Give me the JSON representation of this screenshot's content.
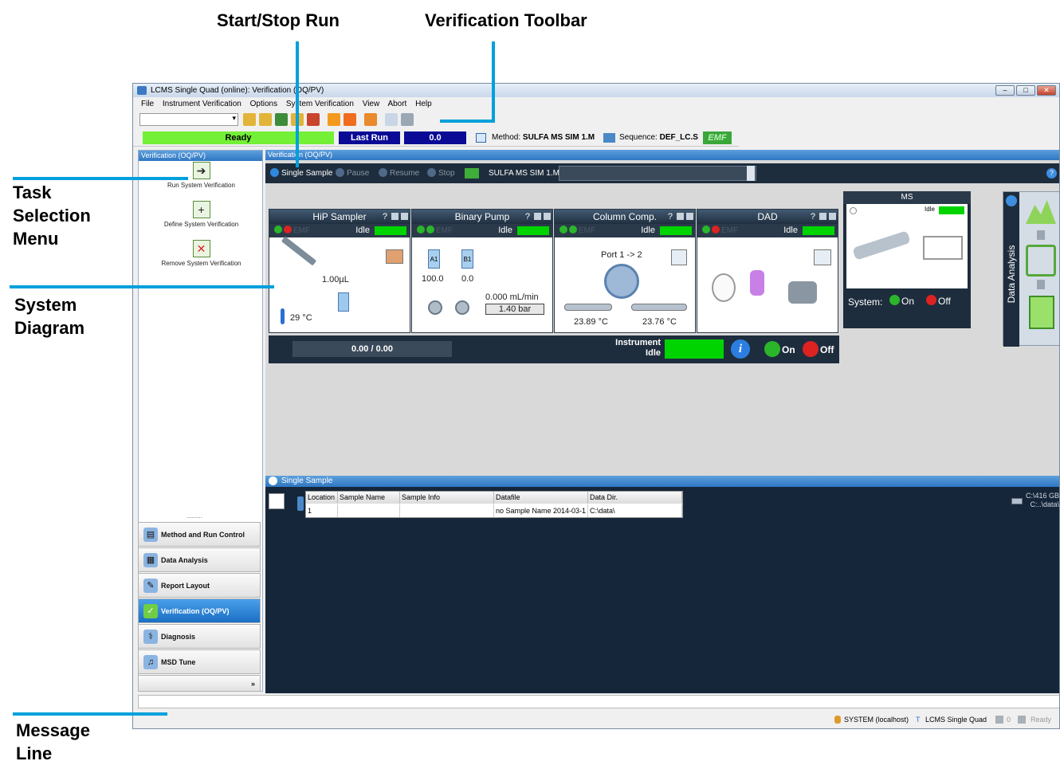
{
  "callouts": {
    "start_stop": "Start/Stop Run",
    "verification_toolbar": "Verification Toolbar",
    "task_selection_1": "Task",
    "task_selection_2": "Selection",
    "task_selection_3": "Menu",
    "system_diagram_1": "System",
    "system_diagram_2": "Diagram",
    "message_line_1": "Message",
    "message_line_2": "Line"
  },
  "window": {
    "title": "LCMS Single Quad (online): Verification (OQ/PV)",
    "menu": [
      "File",
      "Instrument Verification",
      "Options",
      "System Verification",
      "View",
      "Abort",
      "Help"
    ]
  },
  "status": {
    "ready": "Ready",
    "last_run": "Last Run",
    "last_run_value": "0.0",
    "method_label": "Method:",
    "method_value": "SULFA MS SIM 1.M",
    "sequence_label": "Sequence:",
    "sequence_value": "DEF_LC.S",
    "emf": "EMF"
  },
  "left": {
    "panel_title": "Verification (OQ/PV)",
    "tasks": [
      "Run System Verification",
      "Define System Verification",
      "Remove System Verification"
    ],
    "nav": [
      "Method and Run Control",
      "Data Analysis",
      "Report Layout",
      "Verification (OQ/PV)",
      "Diagnosis",
      "MSD Tune"
    ],
    "grip": "........."
  },
  "main": {
    "panel_title": "Verification (OQ/PV)",
    "run_buttons": [
      "Single Sample",
      "Pause",
      "Resume",
      "Stop"
    ],
    "method_name": "SULFA MS SIM 1.M"
  },
  "modules": {
    "sampler": {
      "title": "HiP Sampler",
      "state": "Idle",
      "volume": "1.00µL",
      "temp": "29 °C"
    },
    "pump": {
      "title": "Binary Pump",
      "state": "Idle",
      "a1": "A1",
      "b1": "B1",
      "a_val": "100.0",
      "b_val": "0.0",
      "flow": "0.000 mL/min",
      "pressure": "1.40 bar"
    },
    "column": {
      "title": "Column Comp.",
      "state": "Idle",
      "port": "Port 1 -> 2",
      "temp_left": "23.89 °C",
      "temp_right": "23.76 °C"
    },
    "dad": {
      "title": "DAD",
      "state": "Idle"
    },
    "ms": {
      "title": "MS",
      "state": "Idle",
      "system_label": "System:",
      "on": "On",
      "off": "Off"
    },
    "question": "?",
    "emf": "EMF"
  },
  "bottom": {
    "progress": "0.00 / 0.00",
    "instrument_1": "Instrument",
    "instrument_2": "Idle",
    "on": "On",
    "off": "Off"
  },
  "data_analysis_tab": "Data Analysis",
  "single_sample": {
    "title": "Single Sample",
    "headers": [
      "Location",
      "Sample Name",
      "Sample Info",
      "Datafile",
      "Data Dir."
    ],
    "row": [
      "1",
      "",
      "",
      "no Sample Name 2014-03-1",
      "C:\\data\\"
    ],
    "disk_1": "C:\\416 GB",
    "disk_2": "C:..\\data\\"
  },
  "statusbar": {
    "user": "SYSTEM (localhost)",
    "instrument": "LCMS Single Quad",
    "count": "0",
    "ready": "Ready"
  },
  "colors": {
    "accent_blue": "#00a0dc",
    "idle_green": "#00d400",
    "dark_panel": "#1e2d3d"
  }
}
